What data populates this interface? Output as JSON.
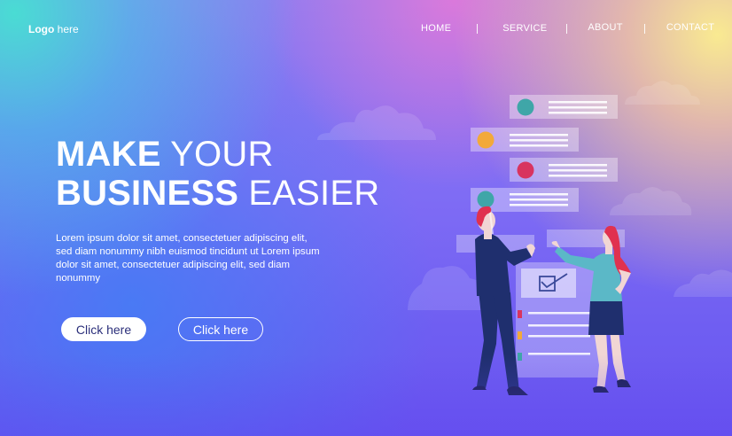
{
  "logo": {
    "bold": "Logo",
    "text": " here"
  },
  "nav": {
    "home": "HOME",
    "service": "SERVICE",
    "about": "ABOUT",
    "contact": "CONTACT"
  },
  "hero": {
    "line1_bold": "MAKE",
    "line1_light": " YOUR",
    "line2_bold": "BUSINESS",
    "line2_light": " EASIER",
    "body": "Lorem ipsum dolor sit amet, consectetuer adipiscing elit, sed diam nonummy nibh euismod tincidunt ut Lorem ipsum dolor sit amet, consectetuer adipiscing elit, sed diam nonummy"
  },
  "buttons": {
    "primary": "Click here",
    "secondary": "Click here"
  },
  "colors": {
    "accent_navy": "#2b2f7a",
    "dot_teal": "#3fa6a8",
    "dot_orange": "#f2a93a",
    "dot_red": "#d8345f"
  }
}
